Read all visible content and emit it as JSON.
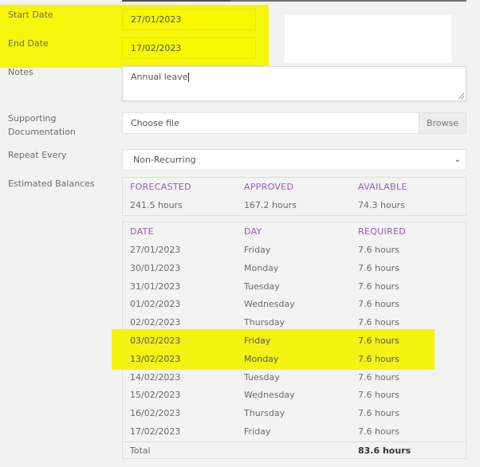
{
  "form": {
    "start_date": {
      "label": "Start Date",
      "value": "27/01/2023"
    },
    "end_date": {
      "label": "End Date",
      "value": "17/02/2023"
    },
    "notes": {
      "label": "Notes",
      "value": "Annual leave"
    },
    "supporting_documentation": {
      "label": "Supporting Documentation",
      "label_line1": "Supporting",
      "label_line2": "Documentation",
      "placeholder": "Choose file",
      "browse_label": "Browse"
    },
    "repeat_every": {
      "label": "Repeat Every",
      "selected": "Non-Recurring"
    },
    "estimated_balances": {
      "label": "Estimated Balances"
    }
  },
  "balances": {
    "headers": [
      "FORECASTED",
      "APPROVED",
      "AVAILABLE"
    ],
    "values": [
      "241.5 hours",
      "167.2 hours",
      "74.3 hours"
    ]
  },
  "schedule": {
    "headers": [
      "DATE",
      "DAY",
      "REQUIRED"
    ],
    "rows": [
      {
        "date": "27/01/2023",
        "day": "Friday",
        "required": "7.6 hours"
      },
      {
        "date": "30/01/2023",
        "day": "Monday",
        "required": "7.6 hours"
      },
      {
        "date": "31/01/2023",
        "day": "Tuesday",
        "required": "7.6 hours"
      },
      {
        "date": "01/02/2023",
        "day": "Wednesday",
        "required": "7.6 hours"
      },
      {
        "date": "02/02/2023",
        "day": "Thursday",
        "required": "7.6 hours"
      },
      {
        "date": "03/02/2023",
        "day": "Friday",
        "required": "7.6 hours",
        "highlighted": true
      },
      {
        "date": "13/02/2023",
        "day": "Monday",
        "required": "7.6 hours",
        "highlighted": true
      },
      {
        "date": "14/02/2023",
        "day": "Tuesday",
        "required": "7.6 hours"
      },
      {
        "date": "15/02/2023",
        "day": "Wednesday",
        "required": "7.6 hours"
      },
      {
        "date": "16/02/2023",
        "day": "Thursday",
        "required": "7.6 hours"
      },
      {
        "date": "17/02/2023",
        "day": "Friday",
        "required": "7.6 hours"
      }
    ],
    "total_label": "Total",
    "total_value": "83.6 hours"
  },
  "colors": {
    "highlight": "#f4f400",
    "header_purple": "#9b5bb8"
  }
}
